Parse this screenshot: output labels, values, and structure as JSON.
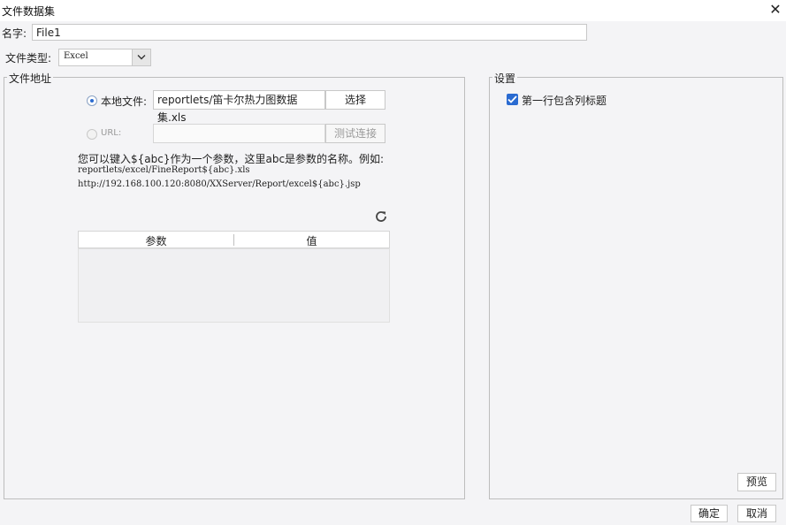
{
  "window": {
    "title": "文件数据集",
    "close_icon": "close-icon"
  },
  "name_field": {
    "label": "名字:",
    "value": "File1"
  },
  "file_type": {
    "label": "文件类型:",
    "selected": "Excel"
  },
  "file_address": {
    "legend": "文件地址",
    "local": {
      "label": "本地文件:",
      "path": "reportlets/笛卡尔热力图数据集.xls",
      "select_button": "选择",
      "checked": true
    },
    "url": {
      "label": "URL:",
      "value": "",
      "test_button": "测试连接",
      "enabled": false
    },
    "hint": {
      "line1": "您可以键入${abc}作为一个参数，这里abc是参数的名称。例如:",
      "line2": "reportlets/excel/FineReport${abc}.xls",
      "line3": "http://192.168.100.120:8080/XXServer/Report/excel${abc}.jsp"
    },
    "refresh_icon": "refresh-icon",
    "params_table": {
      "columns": [
        "参数",
        "值"
      ],
      "rows": []
    }
  },
  "settings": {
    "legend": "设置",
    "first_row_header": {
      "label": "第一行包含列标题",
      "checked": true
    },
    "preview_button": "预览"
  },
  "footer": {
    "ok_button": "确定",
    "cancel_button": "取消"
  },
  "colors": {
    "accent": "#2a6bd1",
    "panel_bg": "#f4f4f6",
    "border": "#bdbdbd"
  }
}
